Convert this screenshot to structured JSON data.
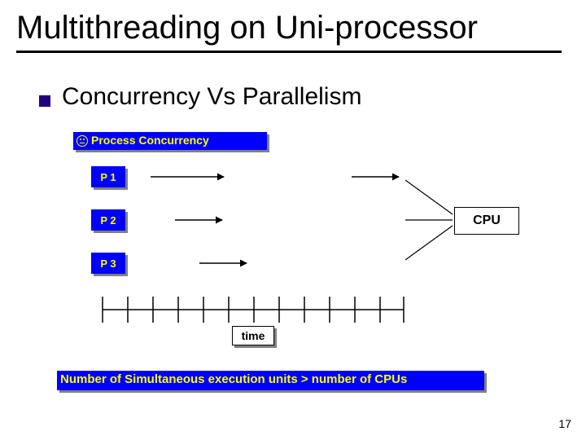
{
  "title": "Multithreading on Uni-processor",
  "bullet1": "Concurrency  Vs  Parallelism",
  "headerBar": "Process Concurrency",
  "processes": {
    "p1": "P 1",
    "p2": "P 2",
    "p3": "P 3"
  },
  "cpu": "CPU",
  "timeLabel": "time",
  "footer": "Number of Simultaneous execution units > number of CPUs",
  "pageNumber": "17"
}
